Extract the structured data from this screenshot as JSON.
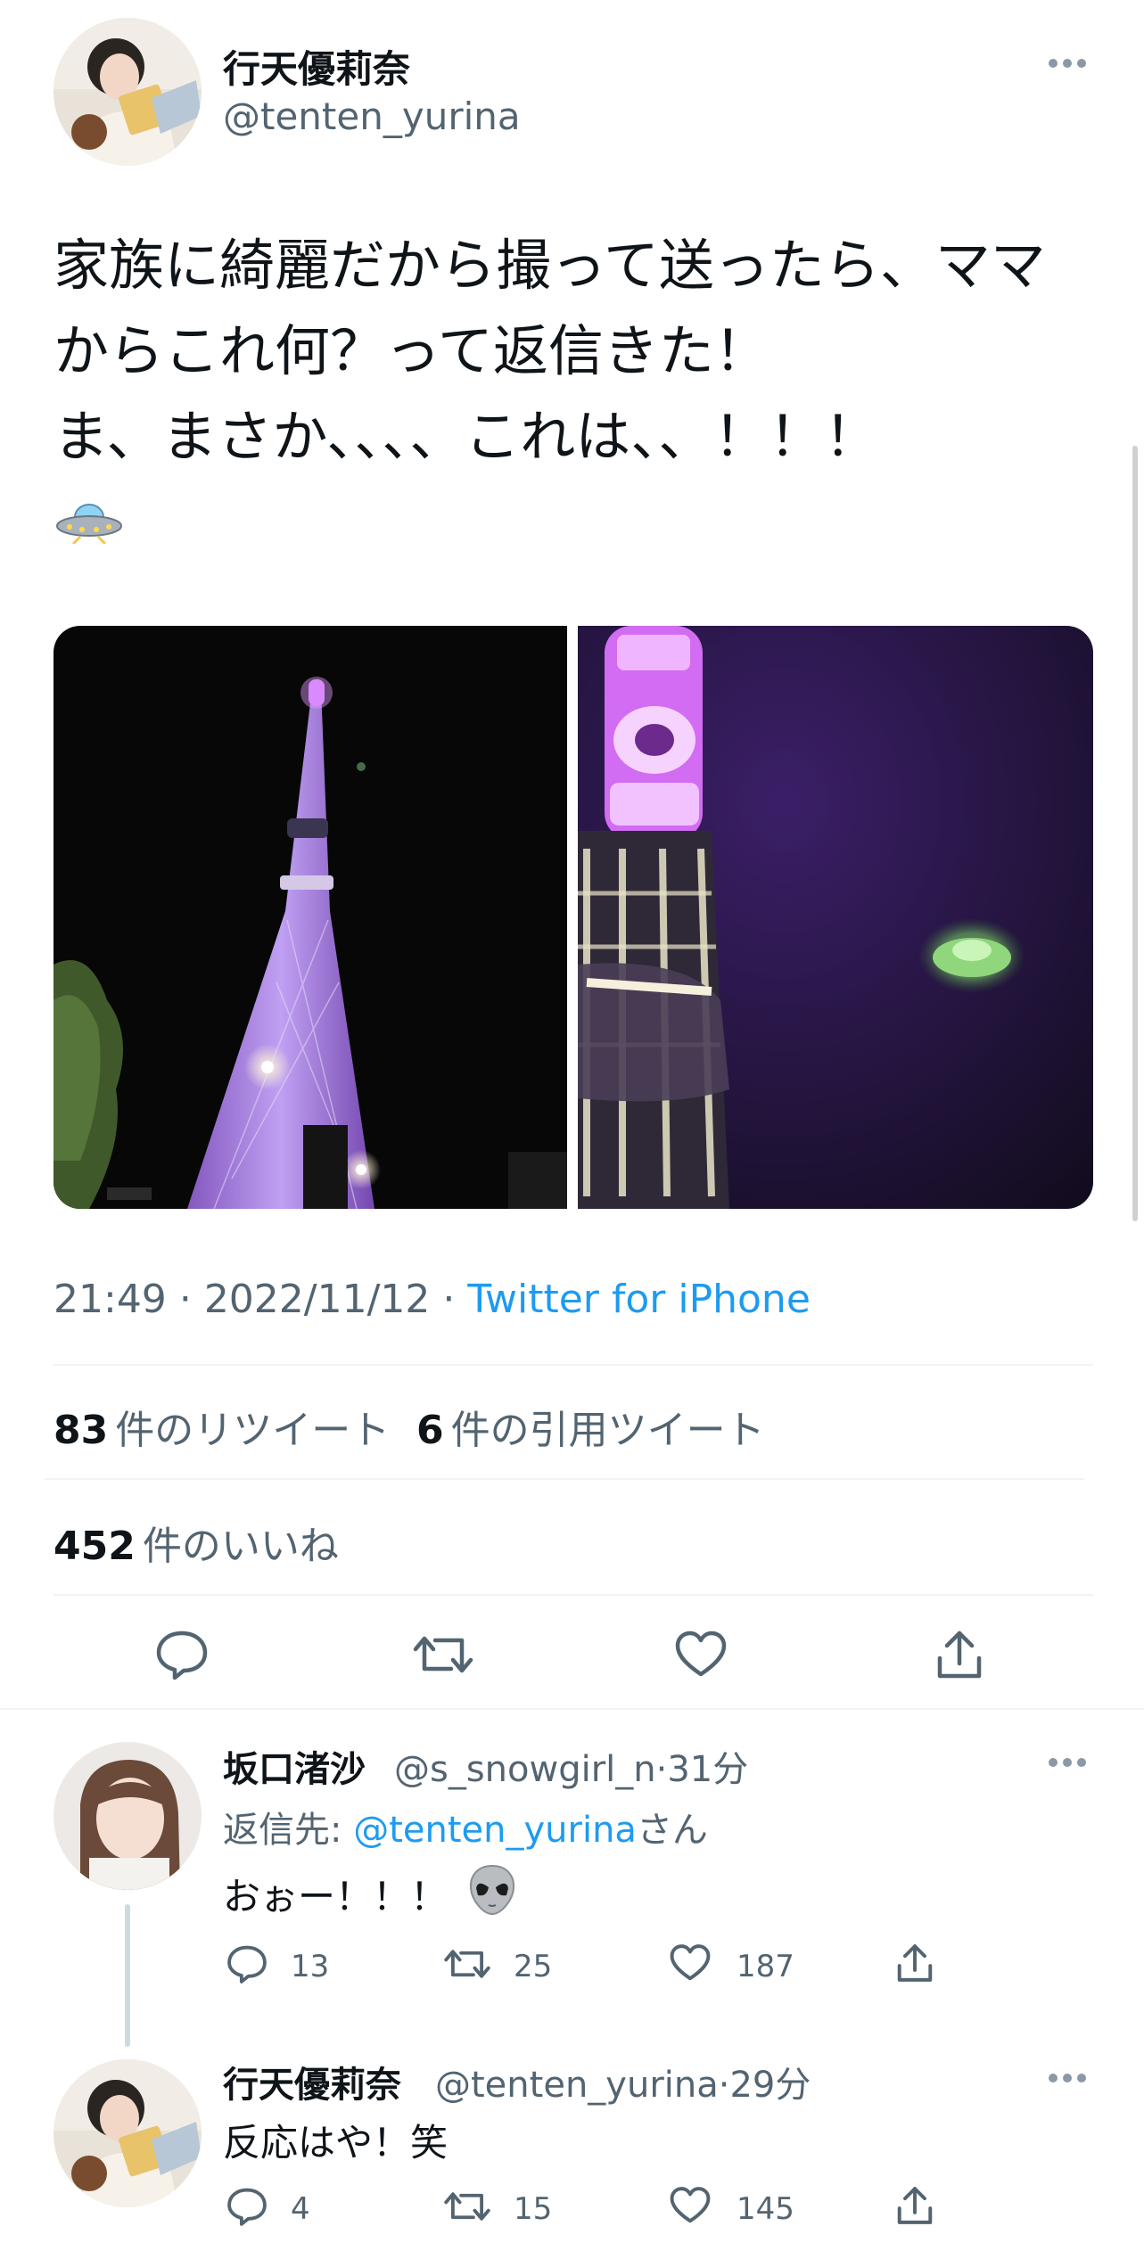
{
  "tweet": {
    "author": {
      "name": "行天優莉奈",
      "handle": "@tenten_yurina"
    },
    "text_lines": [
      "家族に綺麗だから撮って送ったら、ママ",
      "からこれ何？って返信きた！",
      "ま、まさか、、、、これは、、！！！"
    ],
    "emoji_icon": "ufo-icon",
    "time": "21:49",
    "date": "2022/11/12",
    "separator": "·",
    "source": "Twitter for iPhone",
    "retweets_count": "83",
    "retweets_label": "件のリツイート",
    "quotes_count": "6",
    "quotes_label": "件の引用ツイート",
    "likes_count": "452",
    "likes_label": "件のいいね",
    "actions": [
      "reply-icon",
      "retweet-icon",
      "like-icon",
      "share-icon"
    ]
  },
  "replies": [
    {
      "name": "坂口渚沙",
      "handle": "@s_snowgirl_n",
      "time": "31分",
      "replying_label": "返信先:",
      "replying_to": "@tenten_yurina",
      "replying_suffix": "さん",
      "text": "おぉー！！！",
      "emoji_icon": "alien-icon",
      "reply_count": "13",
      "retweet_count": "25",
      "like_count": "187"
    },
    {
      "name": "行天優莉奈",
      "handle": "@tenten_yurina",
      "time": "29分",
      "text": "反応はや！笑",
      "reply_count": "4",
      "retweet_count": "15",
      "like_count": "145"
    }
  ],
  "colors": {
    "text": "#0f1419",
    "secondary": "#536471",
    "link": "#1d9bf0",
    "divider": "#eff3f4",
    "tower_light": "#c77dff"
  }
}
